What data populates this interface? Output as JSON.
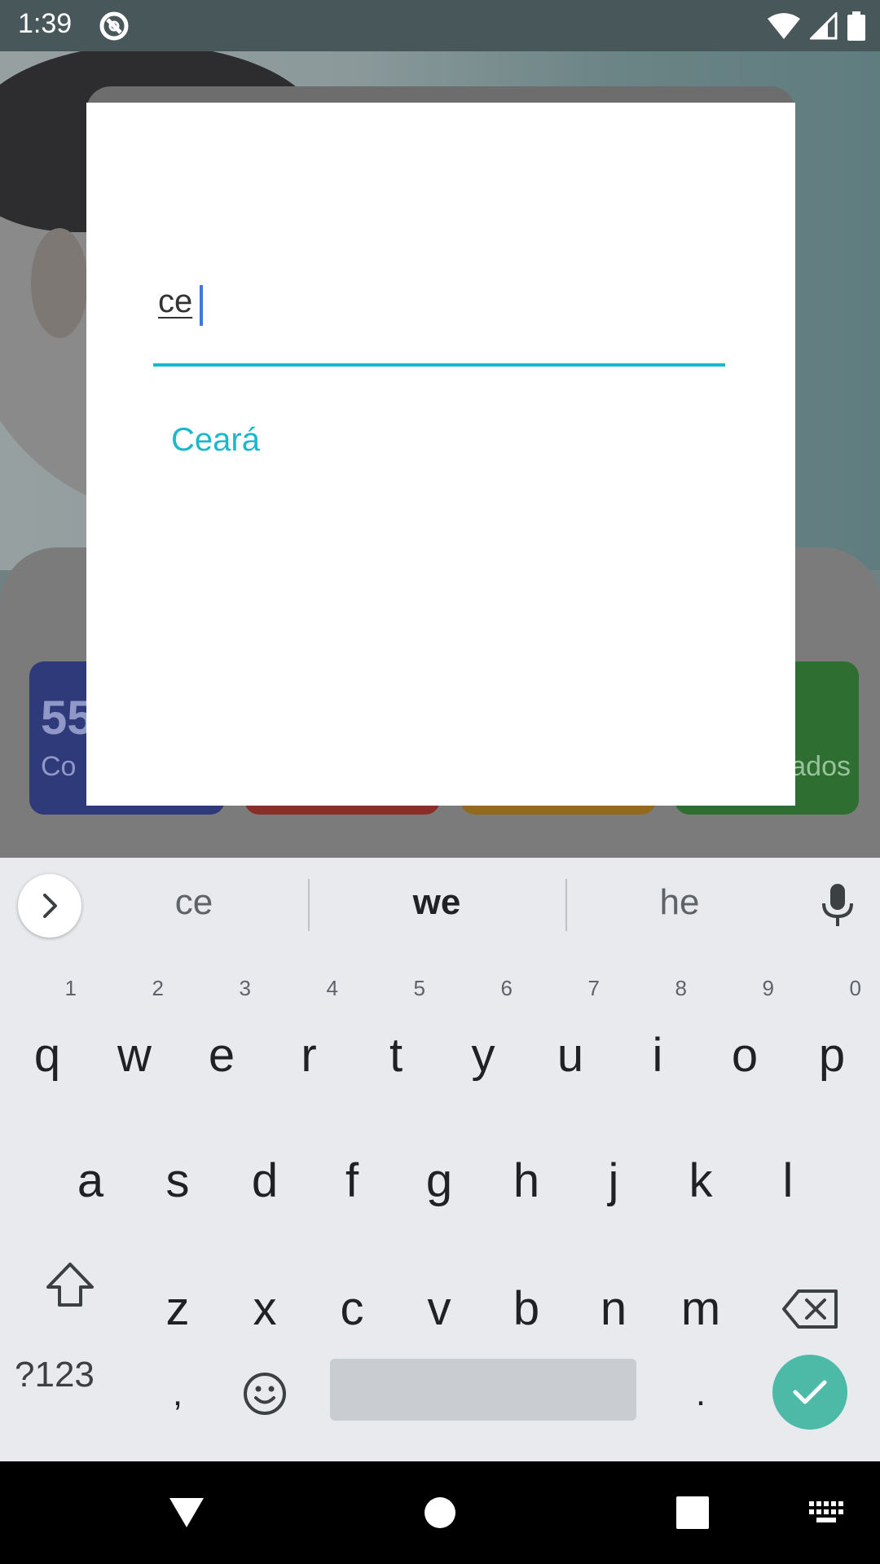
{
  "status_bar": {
    "time": "1:39",
    "icons": [
      "sync-icon",
      "wifi-icon",
      "cell-signal-icon",
      "battery-icon"
    ]
  },
  "background": {
    "cards": [
      {
        "value": "55",
        "label": "Co",
        "color": "#2f3a7a"
      },
      {
        "value": "",
        "label": "",
        "color": "#8a2e2a"
      },
      {
        "value": "",
        "label": "",
        "color": "#93691d"
      },
      {
        "value": "",
        "label": "ados",
        "color": "#2e6e31"
      }
    ]
  },
  "dialog": {
    "search_value": "ce",
    "suggestions": [
      "Ceará"
    ],
    "accent_color": "#1ab8cc"
  },
  "keyboard": {
    "suggestions": [
      "ce",
      "we",
      "he"
    ],
    "row1": [
      {
        "key": "q",
        "hint": "1"
      },
      {
        "key": "w",
        "hint": "2"
      },
      {
        "key": "e",
        "hint": "3"
      },
      {
        "key": "r",
        "hint": "4"
      },
      {
        "key": "t",
        "hint": "5"
      },
      {
        "key": "y",
        "hint": "6"
      },
      {
        "key": "u",
        "hint": "7"
      },
      {
        "key": "i",
        "hint": "8"
      },
      {
        "key": "o",
        "hint": "9"
      },
      {
        "key": "p",
        "hint": "0"
      }
    ],
    "row2": [
      "a",
      "s",
      "d",
      "f",
      "g",
      "h",
      "j",
      "k",
      "l"
    ],
    "row3": [
      "z",
      "x",
      "c",
      "v",
      "b",
      "n",
      "m"
    ],
    "symbols_label": "?123",
    "comma": ",",
    "period": ".",
    "enter_color": "#4dbaa8"
  },
  "nav_bar": {
    "buttons": [
      "back-icon",
      "home-icon",
      "recents-icon",
      "keyboard-switch-icon"
    ]
  }
}
